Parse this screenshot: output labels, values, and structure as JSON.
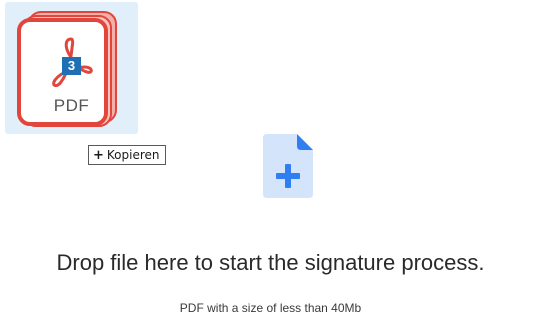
{
  "dragged_file": {
    "type_label": "PDF",
    "badge_count": "3",
    "icon": "pdf-document-stack-icon"
  },
  "copy_tooltip": {
    "symbol": "+",
    "label": "Kopieren"
  },
  "dropzone": {
    "icon": "file-add-icon",
    "headline": "Drop file here to start the signature process.",
    "subline": "PDF with a size of less than 40Mb"
  },
  "colors": {
    "pdf_red": "#e2453c",
    "accent_blue": "#2f7ff0",
    "upload_icon_fill": "#d3e4fb",
    "badge_blue": "#1f6fb5"
  }
}
